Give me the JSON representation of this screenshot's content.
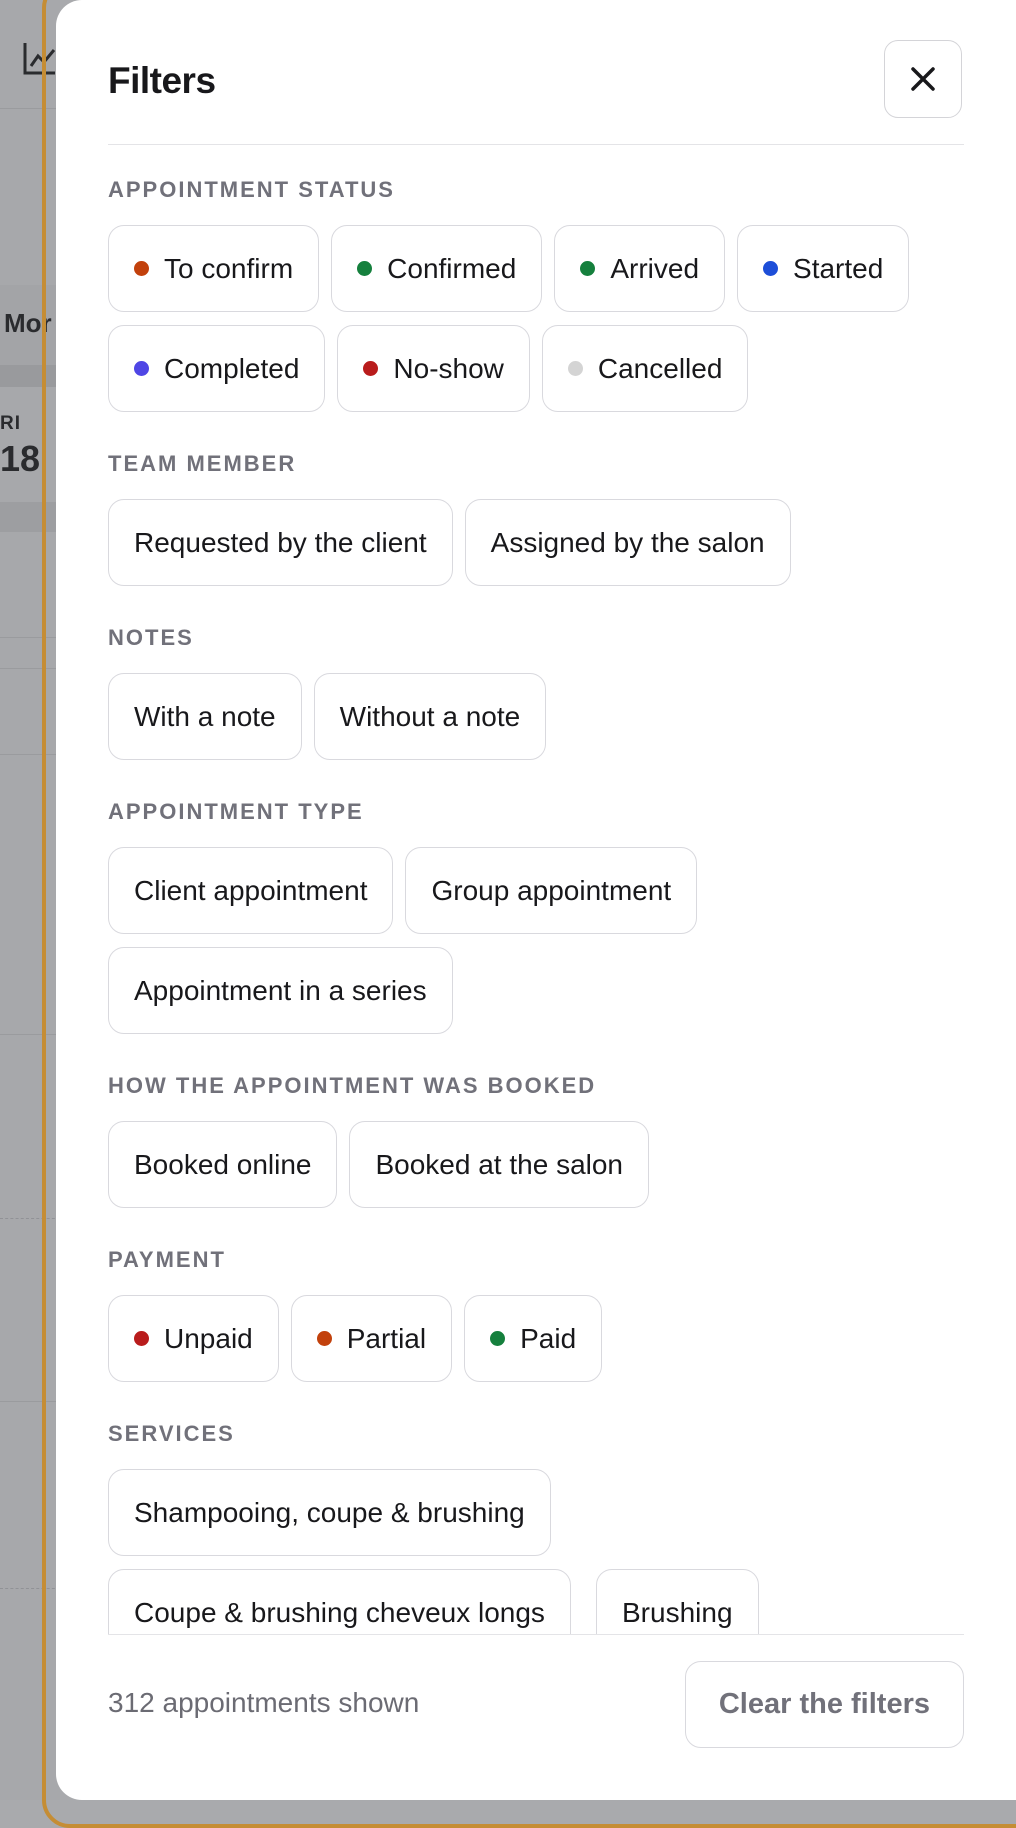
{
  "background": {
    "mon_label": "Mor",
    "fri_label": "RI",
    "day_number": "18"
  },
  "drawer": {
    "title": "Filters",
    "close_icon": "close-icon",
    "sections": [
      {
        "title": "APPOINTMENT STATUS",
        "chips": [
          {
            "label": "To confirm",
            "dot": "#c2410c"
          },
          {
            "label": "Confirmed",
            "dot": "#15803d"
          },
          {
            "label": "Arrived",
            "dot": "#15803d"
          },
          {
            "label": "Started",
            "dot": "#1d4ed8"
          },
          {
            "label": "Completed",
            "dot": "#4f46e5"
          },
          {
            "label": "No-show",
            "dot": "#b91c1c"
          },
          {
            "label": "Cancelled",
            "dot": "#d4d4d4"
          }
        ]
      },
      {
        "title": "TEAM MEMBER",
        "chips": [
          {
            "label": "Requested by the client"
          },
          {
            "label": "Assigned by the salon"
          }
        ]
      },
      {
        "title": "NOTES",
        "chips": [
          {
            "label": "With a note"
          },
          {
            "label": "Without a note"
          }
        ]
      },
      {
        "title": "APPOINTMENT TYPE",
        "chips": [
          {
            "label": "Client appointment"
          },
          {
            "label": "Group appointment"
          },
          {
            "label": "Appointment in a series"
          }
        ]
      },
      {
        "title": "HOW THE APPOINTMENT WAS BOOKED",
        "chips": [
          {
            "label": "Booked online"
          },
          {
            "label": "Booked at the salon"
          }
        ]
      },
      {
        "title": "PAYMENT",
        "chips": [
          {
            "label": "Unpaid",
            "dot": "#b91c1c"
          },
          {
            "label": "Partial",
            "dot": "#c2410c"
          },
          {
            "label": "Paid",
            "dot": "#15803d"
          }
        ]
      },
      {
        "title": "SERVICES",
        "chips": [
          {
            "label": "Shampooing, coupe & brushing"
          },
          {
            "label": "Coupe & brushing cheveux longs"
          },
          {
            "label": "Brushing"
          }
        ]
      }
    ],
    "footer": {
      "count_text": "312 appointments shown",
      "clear_label": "Clear the filters"
    }
  }
}
